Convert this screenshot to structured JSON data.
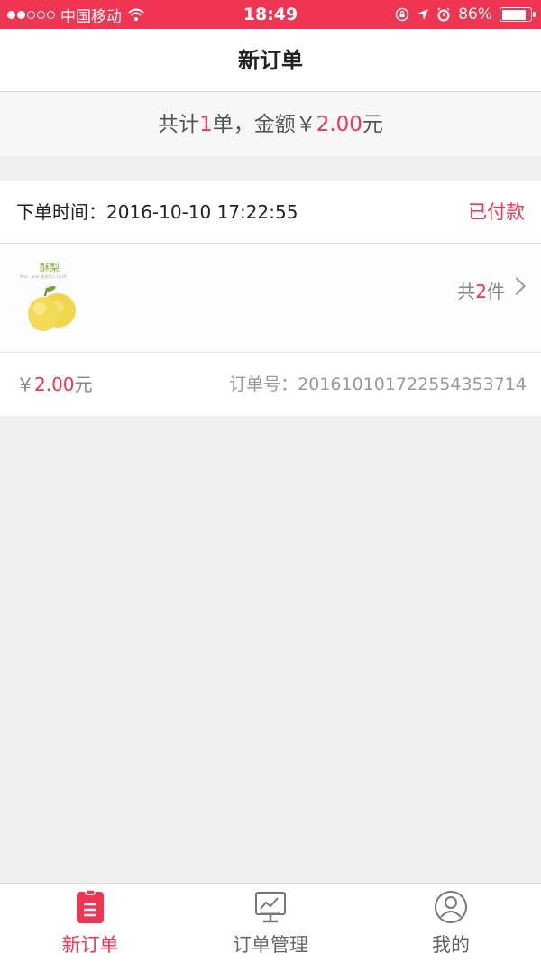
{
  "status_bar": {
    "carrier": "中国移动",
    "time": "18:49",
    "battery": "86%",
    "battery_level": 0.86
  },
  "nav": {
    "title": "新订单"
  },
  "summary": {
    "prefix": "共计",
    "count": "1",
    "mid": "单，金额￥",
    "amount": "2.00",
    "suffix": "元"
  },
  "order": {
    "time_label": "下单时间：",
    "time": "2016-10-10 17:22:55",
    "status": "已付款",
    "product": {
      "title": "酥梨",
      "subtitle": "Pear · pear  香甜可口  1斤/件"
    },
    "count_prefix": "共",
    "count": "2",
    "count_suffix": "件",
    "price_prefix": "￥",
    "price": "2.00",
    "price_suffix": "元",
    "order_no_label": "订单号：",
    "order_no": "201610101722554353714"
  },
  "tabs": [
    {
      "label": "新订单",
      "icon": "clipboard-icon",
      "active": true
    },
    {
      "label": "订单管理",
      "icon": "chart-monitor-icon",
      "active": false
    },
    {
      "label": "我的",
      "icon": "user-icon",
      "active": false
    }
  ],
  "colors": {
    "accent": "#ef3551",
    "background": "#efefef"
  }
}
